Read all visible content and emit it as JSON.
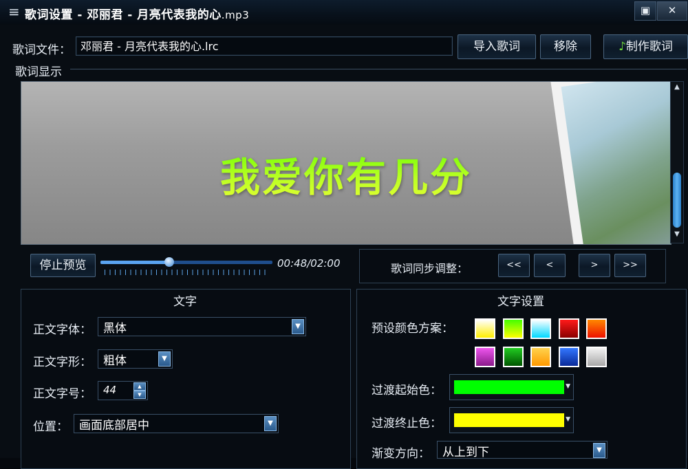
{
  "window": {
    "title": "歌词设置 - 邓丽君 - 月亮代表我的心",
    "title_ext": ".mp3",
    "menu_icon": "≡",
    "maximize_icon": "▣",
    "close_icon": "✕"
  },
  "file_row": {
    "label": "歌词文件：",
    "value": "邓丽君 - 月亮代表我的心.lrc",
    "import_label": "导入歌词",
    "remove_label": "移除",
    "make_label": "制作歌词",
    "make_icon": "♪"
  },
  "display": {
    "group_label": "歌词显示",
    "lyric": "我爱你有几分",
    "scroll_up": "▲",
    "scroll_down": "▼"
  },
  "playback": {
    "stop_label": "停止预览",
    "time": "00:48/02:00",
    "progress": 0.4
  },
  "sync": {
    "label": "歌词同步调整：",
    "buttons": [
      "<<",
      "<",
      ">",
      ">>"
    ]
  },
  "text_panel": {
    "title": "文字",
    "font_label": "正文字体：",
    "font_value": "黑体",
    "style_label": "正文字形：",
    "style_value": "粗体",
    "size_label": "正文字号：",
    "size_value": "44",
    "position_label": "位置：",
    "position_value": "画面底部居中"
  },
  "settings_panel": {
    "title": "文字设置",
    "preset_label": "预设颜色方案：",
    "presets": [
      [
        "#ffffff",
        "#ffee00"
      ],
      [
        "#44ff00",
        "#ffff00"
      ],
      [
        "#ffffff",
        "#00d8ff"
      ],
      [
        "#ff1a1a",
        "#8a0000"
      ],
      [
        "#ff8800",
        "#ee1100"
      ],
      [
        "#ee55ee",
        "#8a1a8a"
      ],
      [
        "#22cc22",
        "#005500"
      ],
      [
        "#ffd24d",
        "#ff9900"
      ],
      [
        "#3377ff",
        "#0a2a99"
      ],
      [
        "#f2f2f2",
        "#a8a8a8"
      ]
    ],
    "start_label": "过渡起始色：",
    "start_color": "#00ff00",
    "end_label": "过渡终止色：",
    "end_color": "#ffff00",
    "direction_label": "渐变方向：",
    "direction_value": "从上到下"
  }
}
